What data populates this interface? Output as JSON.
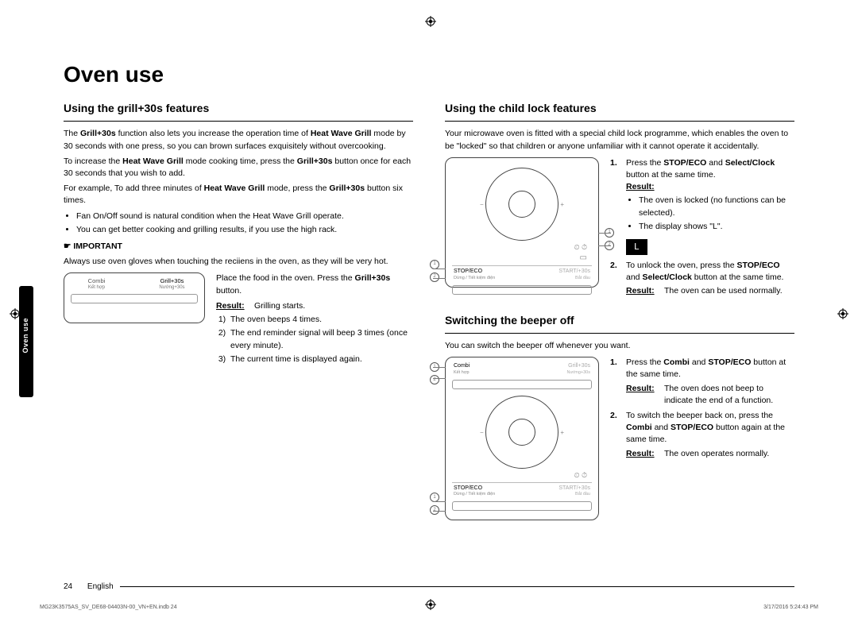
{
  "chapter": "Oven use",
  "sideTab": "Oven use",
  "pageNum": "24",
  "pageLang": "English",
  "printLeft": "MG23K3575AS_SV_DE68-04403N-00_VN+EN.indb   24",
  "printRight": "3/17/2016   5:24:43 PM",
  "left": {
    "h": "Using the grill+30s features",
    "p1a": "The ",
    "p1b": "Grill+30s",
    "p1c": " function also lets you increase the operation time of ",
    "p1d": "Heat Wave Grill",
    "p1e": " mode by 30 seconds with one press, so you can brown surfaces exquisitely without overcooking.",
    "p2a": "To increase the ",
    "p2b": "Heat Wave Grill",
    "p2c": " mode cooking time, press the ",
    "p2d": "Grill+30s",
    "p2e": " button once for each 30 seconds that you wish to add.",
    "p3a": "For example, To add three minutes of ",
    "p3b": "Heat Wave Grill",
    "p3c": " mode, press the ",
    "p3d": "Grill+30s",
    "p3e": " button six times.",
    "b1": "Fan On/Off sound is natural condition when the Heat Wave Grill operate.",
    "b2": "You can get better cooking and grilling results, if you use the high rack.",
    "impIcon": "☛",
    "imp": "IMPORTANT",
    "p4": "Always use oven gloves when touching the reciiens in the oven, as they will be very hot.",
    "panel": {
      "combi": "Combi",
      "combiSub": "Kết hợp",
      "grill": "Grill+30s",
      "grillSub": "Nướng+30s"
    },
    "step1a": "Place the food in the oven. Press the ",
    "step1b": "Grill+30s",
    "step1c": " button.",
    "res": "Result:",
    "resText": "Grilling starts.",
    "l1": "The oven beeps 4 times.",
    "l2": "The end reminder signal will beep 3 times (once every minute).",
    "l3": "The current time is displayed again."
  },
  "right": {
    "h1": "Using the child lock features",
    "p1": "Your microwave oven is fitted with a special child lock programme, which enables the oven to be \"locked\" so that children or anyone unfamiliar with it cannot operate it accidentally.",
    "panelTop": {
      "stop": "STOP/ECO",
      "stopSub": "Dừng / Tiết kiệm điện",
      "start": "START/+30s",
      "startSub": "Bắt đầu"
    },
    "step1a": "Press the ",
    "step1b": "STOP/ECO",
    "step1c": " and ",
    "step1d": "Select/Clock",
    "step1e": " button at the same time.",
    "res": "Result:",
    "b1": "The oven is locked (no functions can be selected).",
    "b2": "The display shows \"L\".",
    "dispL": "L",
    "step2a": "To unlock the oven, press the ",
    "step2b": "STOP/ECO",
    "step2c": " and ",
    "step2d": "Select/Clock",
    "step2e": " button at the same time.",
    "res2text": "The oven can be used normally.",
    "h2": "Switching the beeper off",
    "p2": "You can switch the beeper off whenever you want.",
    "panel2": {
      "combi": "Combi",
      "combiSub": "Kết hợp",
      "grill": "Grill+30s",
      "grillSub": "Nướng+30s",
      "stop": "STOP/ECO",
      "stopSub": "Dừng / Tiết kiệm điện",
      "start": "START/+30s",
      "startSub": "Bắt đầu"
    },
    "bstep1a": "Press the ",
    "bstep1b": "Combi",
    "bstep1c": " and ",
    "bstep1d": "STOP/ECO",
    "bstep1e": " button at the same time.",
    "bres1": "The oven does not beep to indicate the end of a function.",
    "bstep2a": "To switch the beeper back on, press the ",
    "bstep2b": "Combi",
    "bstep2c": " and ",
    "bstep2d": "STOP/ECO",
    "bstep2e": " button again at the same time.",
    "bres2": "The oven operates normally."
  }
}
